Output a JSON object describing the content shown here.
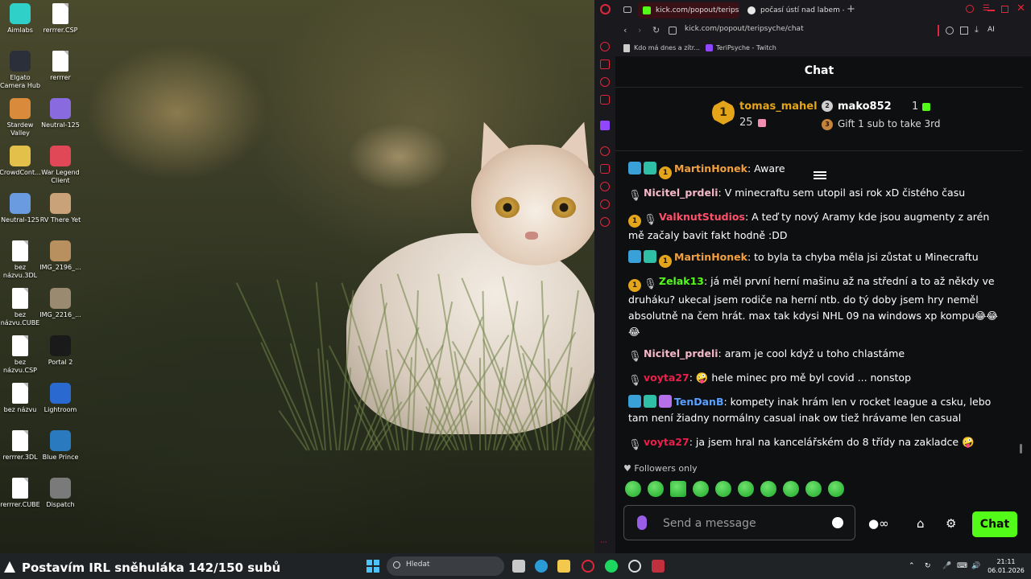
{
  "desktop": {
    "icons": [
      {
        "label": "Aimlabs"
      },
      {
        "label": "rerrrer.CSP"
      },
      {
        "label": "Elgato Camera Hub"
      },
      {
        "label": "rerrrer"
      },
      {
        "label": "Stardew Valley"
      },
      {
        "label": "Neutral-125"
      },
      {
        "label": "CrowdCont..."
      },
      {
        "label": "War Legend Client"
      },
      {
        "label": "Neutral-125"
      },
      {
        "label": "RV There Yet"
      },
      {
        "label": "bez názvu.3DL"
      },
      {
        "label": "IMG_2196_..."
      },
      {
        "label": "bez názvu.CUBE"
      },
      {
        "label": "IMG_2216_..."
      },
      {
        "label": "bez názvu.CSP"
      },
      {
        "label": "Portal 2"
      },
      {
        "label": "bez názvu"
      },
      {
        "label": "Lightroom"
      },
      {
        "label": "rerrrer.3DL"
      },
      {
        "label": "Blue Prince"
      },
      {
        "label": "rerrrer.CUBE"
      },
      {
        "label": "Dispatch"
      }
    ]
  },
  "browser": {
    "tabs": [
      {
        "label": "kick.com/popout/teripsych",
        "active": true
      },
      {
        "label": "počasí ústí nad labem - Hl",
        "active": false
      }
    ],
    "url": "kick.com/popout/teripsyche/chat",
    "ai_label": "AI",
    "bookmarks": [
      {
        "label": "Kdo má dnes a zítr..."
      },
      {
        "label": "TeriPsyche - Twitch"
      }
    ]
  },
  "chat": {
    "title": "Chat",
    "leaderboard": {
      "first": {
        "rank": "1",
        "name": "tomas_mahel",
        "count": "25"
      },
      "second": {
        "rank": "2",
        "name": "mako852",
        "count": "1"
      },
      "third": {
        "rank": "3",
        "text": "Gift 1 sub to take 3rd"
      }
    },
    "messages": [
      {
        "user": "MartinHonek",
        "color": "#f0a040",
        "text": ": Aware"
      },
      {
        "user": "Nicitel_prdeli",
        "color": "#f4b8c8",
        "text": ": V minecraftu sem utopil asi rok xD čistého času"
      },
      {
        "user": "ValknutStudios",
        "color": "#ff4f6a",
        "text": ": A teď ty nový Aramy kde jsou augmenty z arén mě začaly bavit fakt hodně :DD"
      },
      {
        "user": "MartinHonek",
        "color": "#f0a040",
        "text": ": to byla ta chyba měla jsi zůstat u Minecraftu"
      },
      {
        "user": "Zelak13",
        "color": "#53fc18",
        "text": ": já měl první herní mašinu až na střední a to až někdy ve druháku? ukecal jsem rodiče na herní ntb. do tý doby jsem hry neměl absolutně na čem hrát. max tak kdysi NHL 09 na windows xp kompu😂😂😂"
      },
      {
        "user": "Nicitel_prdeli",
        "color": "#f4b8c8",
        "text": ": aram je cool když u toho chlastáme"
      },
      {
        "user": "voyta27",
        "color": "#e8204a",
        "text": ": 🤪 hele minec pro mě byl covid ... nonstop"
      },
      {
        "user": "TenDanB",
        "color": "#5aa0ff",
        "text": ": kompety inak hrám len v rocket league a csku, lebo tam není žiadny normálny casual inak ow tiež hrávame len casual"
      },
      {
        "user": "voyta27",
        "color": "#e8204a",
        "text": ": ja jsem hral na kancelářském do 8 třídy na zakladce 🤪"
      }
    ],
    "followers_only": "Followers only",
    "input_placeholder": "Send a message",
    "send_label": "Chat",
    "accent": "#53fc18"
  },
  "taskbar": {
    "widget_text": "Postavím IRL sněhuláka 142/150 subů",
    "search_placeholder": "Hledat",
    "time": "21:11",
    "date": "06.01.2026"
  }
}
